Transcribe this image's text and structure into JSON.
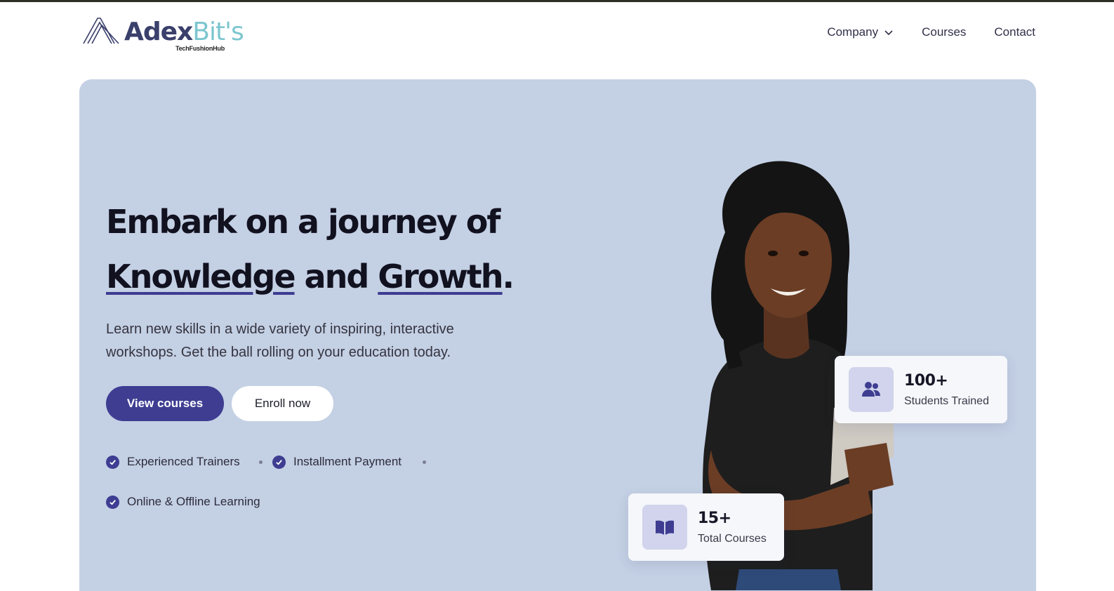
{
  "brand": {
    "name_part1": "Adex",
    "name_part2": "Bit's",
    "tagline": "TechFushionHub"
  },
  "nav": {
    "items": [
      {
        "label": "Company",
        "has_dropdown": true
      },
      {
        "label": "Courses",
        "has_dropdown": false
      },
      {
        "label": "Contact",
        "has_dropdown": false
      }
    ]
  },
  "hero": {
    "headline_line1": "Embark on a journey of",
    "headline_word1": "Knowledge",
    "headline_and": "and",
    "headline_word2": "Growth",
    "headline_period": ".",
    "description": "Learn new skills in a wide variety of inspiring, interactive workshops. Get the ball rolling on your education today.",
    "primary_button": "View courses",
    "secondary_button": "Enroll now",
    "features": [
      {
        "label": "Experienced Trainers",
        "icon": "check-circle-icon"
      },
      {
        "label": "Installment Payment",
        "icon": "check-circle-icon"
      },
      {
        "label": "Online & Offline Learning",
        "icon": "check-circle-icon"
      }
    ]
  },
  "stats": {
    "students": {
      "value": "100+",
      "label": "Students Trained",
      "icon": "users-icon"
    },
    "courses": {
      "value": "15+",
      "label": "Total Courses",
      "icon": "book-icon"
    }
  },
  "colors": {
    "accent": "#3e3d92",
    "hero_bg": "#c4d0e4",
    "brand_dark": "#3a3f6b",
    "brand_light": "#7cc6cf"
  }
}
